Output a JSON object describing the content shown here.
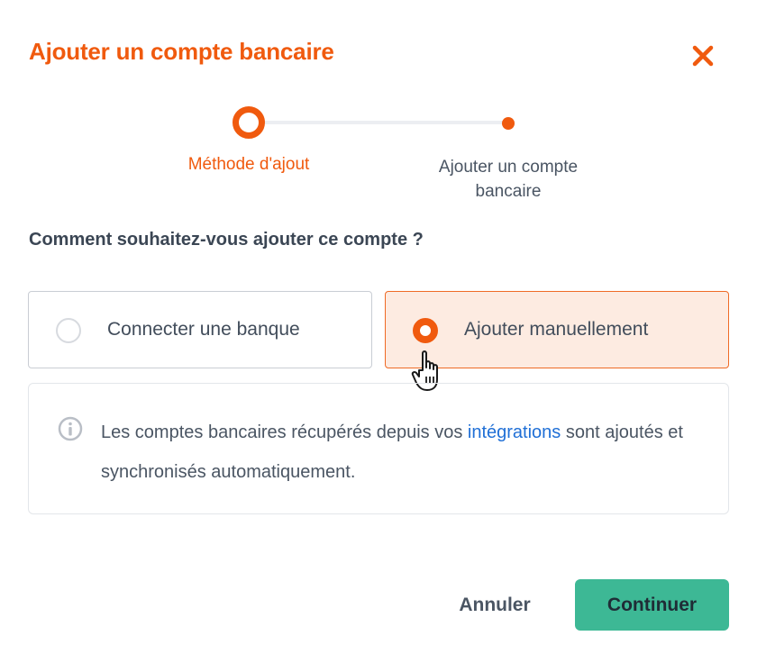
{
  "dialog": {
    "title": "Ajouter un compte bancaire",
    "close_icon": "close-icon"
  },
  "stepper": {
    "steps": [
      {
        "label": "Méthode d'ajout",
        "state": "active"
      },
      {
        "label": "Ajouter un compte bancaire",
        "state": "upcoming"
      }
    ]
  },
  "question": "Comment souhaitez-vous ajouter ce compte ?",
  "options": [
    {
      "label": "Connecter une banque",
      "selected": false
    },
    {
      "label": "Ajouter manuellement",
      "selected": true
    }
  ],
  "info": {
    "icon": "info-icon",
    "text_before": "Les comptes bancaires récupérés depuis vos ",
    "link": "intégrations",
    "text_after": " sont ajoutés et synchronisés automatiquement."
  },
  "footer": {
    "cancel_label": "Annuler",
    "continue_label": "Continuer"
  },
  "colors": {
    "accent": "#f05a0e",
    "primary_button": "#3db895",
    "link": "#1f6fd6",
    "selected_bg": "#fdebe1"
  }
}
